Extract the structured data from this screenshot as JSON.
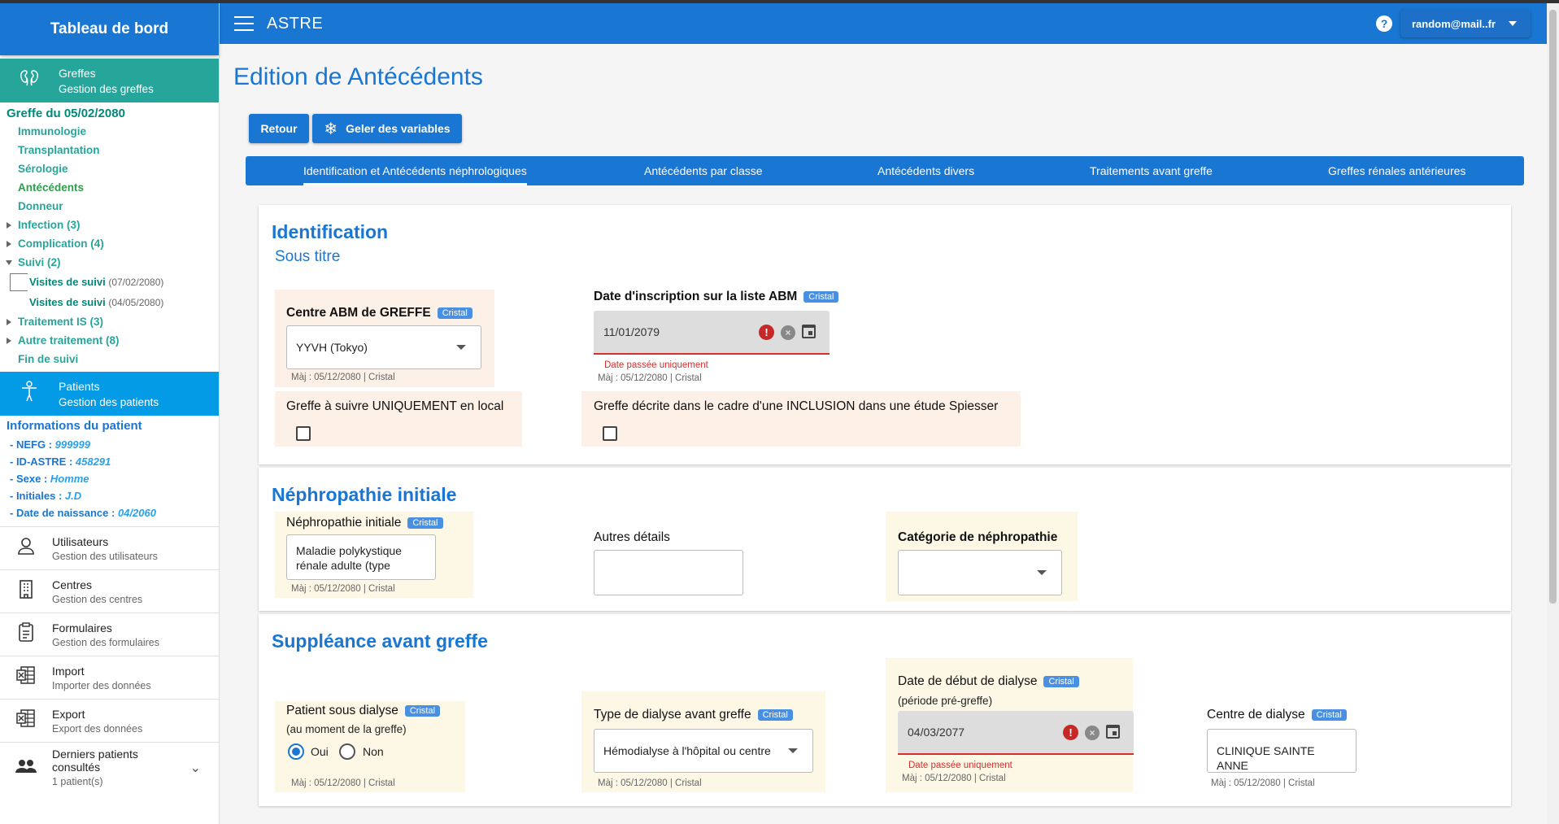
{
  "app": {
    "name": "ASTRE",
    "user": "random@mail..fr"
  },
  "sidebar": {
    "header": "Tableau de bord",
    "greffes_module": {
      "title": "Greffes",
      "subtitle": "Gestion des greffes"
    },
    "greffe_title": "Greffe du 05/02/2080",
    "nav": [
      {
        "label": "Immunologie"
      },
      {
        "label": "Transplantation"
      },
      {
        "label": "Sérologie"
      },
      {
        "label": "Antécédents"
      },
      {
        "label": "Donneur"
      },
      {
        "label": "Infection (3)"
      },
      {
        "label": "Complication (4)"
      },
      {
        "label": "Suivi (2)"
      },
      {
        "label": "Traitement IS (3)"
      },
      {
        "label": "Autre traitement (8)"
      },
      {
        "label": "Fin de suivi"
      }
    ],
    "suivi_items": [
      {
        "label": "Visites de suivi",
        "date": "(07/02/2080)"
      },
      {
        "label": "Visites de suivi",
        "date": "(04/05/2080)"
      }
    ],
    "patients_module": {
      "title": "Patients",
      "subtitle": "Gestion des patients"
    },
    "patient_info_title": "Informations du patient",
    "patient_info": [
      {
        "label": "- NEFG : ",
        "value": "999999"
      },
      {
        "label": "- ID-ASTRE : ",
        "value": "458291"
      },
      {
        "label": "- Sexe : ",
        "value": "Homme"
      },
      {
        "label": "- Initiales : ",
        "value": "J.D"
      },
      {
        "label": "- Date de naissance : ",
        "value": "04/2060"
      }
    ],
    "menu": [
      {
        "title": "Utilisateurs",
        "subtitle": "Gestion des utilisateurs"
      },
      {
        "title": "Centres",
        "subtitle": "Gestion des centres"
      },
      {
        "title": "Formulaires",
        "subtitle": "Gestion des formulaires"
      },
      {
        "title": "Import",
        "subtitle": "Importer des données"
      },
      {
        "title": "Export",
        "subtitle": "Export des données"
      },
      {
        "title": "Derniers patients consultés",
        "subtitle": "1 patient(s)"
      }
    ]
  },
  "page": {
    "title": "Edition de Antécédents",
    "buttons": {
      "back": "Retour",
      "freeze": "Geler des variables"
    },
    "tabs": [
      "Identification et Antécédents néphrologiques",
      "Antécédents par classe",
      "Antécédents divers",
      "Traitements avant greffe",
      "Greffes rénales antérieures"
    ]
  },
  "chip": "Cristal",
  "maj": "Màj : 05/12/2080 | Cristal",
  "identification": {
    "title": "Identification",
    "subtitle": "Sous titre",
    "centre_label": "Centre ABM de GREFFE",
    "centre_value": "YYVH (Tokyo)",
    "date_label": "Date d'inscription sur la liste ABM",
    "date_value": "11/01/2079",
    "date_error": "Date passée uniquement",
    "local_label": "Greffe à suivre UNIQUEMENT en local",
    "inclusion_label": "Greffe décrite dans le cadre d'une INCLUSION dans une étude Spiesser"
  },
  "nephropathie": {
    "title": "Néphropathie initiale",
    "field_label": "Néphropathie initiale",
    "field_value": "Maladie polykystique rénale adulte (type",
    "details_label": "Autres détails",
    "categorie_label": "Catégorie de néphropathie"
  },
  "suppleance": {
    "title": "Suppléance avant greffe",
    "dialyse_label": "Patient sous dialyse",
    "dialyse_note": "(au moment de la greffe)",
    "yes": "Oui",
    "no": "Non",
    "type_label": "Type de dialyse avant greffe",
    "type_value": "Hémodialyse à l'hôpital ou centre",
    "debut_label": "Date de début de dialyse",
    "debut_note": "(période pré-greffe)",
    "debut_value": "04/03/2077",
    "debut_error": "Date passée uniquement",
    "centre_label": "Centre de dialyse",
    "centre_value": "CLINIQUE SAINTE ANNE"
  },
  "icons": {
    "menu": "hamburger-icon",
    "help": "help-icon",
    "freeze": "snowflake-icon"
  }
}
